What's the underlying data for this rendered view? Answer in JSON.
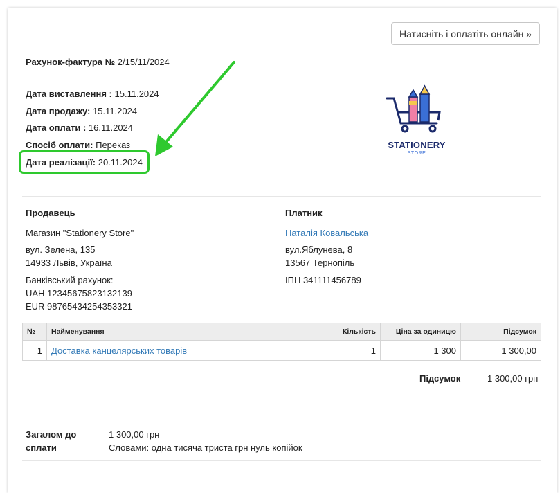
{
  "pay_button": {
    "label": "Натисніть і оплатіть онлайн »"
  },
  "invoice": {
    "title_label": "Рахунок-фактура №",
    "number": "2/15/11/2024"
  },
  "dates": [
    {
      "label": "Дата виставлення :",
      "value": "15.11.2024"
    },
    {
      "label": "Дата продажу:",
      "value": "15.11.2024"
    },
    {
      "label": "Дата оплати :",
      "value": "16.11.2024"
    },
    {
      "label": "Спосіб оплати:",
      "value": "Переказ"
    },
    {
      "label": "Дата реалізації:",
      "value": "20.11.2024"
    }
  ],
  "logo": {
    "name": "STATIONERY",
    "sub": "STORE"
  },
  "seller": {
    "heading": "Продавець",
    "name": "Магазин \"Stationery Store\"",
    "address1": "вул. Зелена, 135",
    "address2": "14933 Львів, Україна",
    "bank_label": "Банківський рахунок:",
    "bank_uah": "UAH 12345675823132139",
    "bank_eur": "EUR 98765434254353321"
  },
  "payer": {
    "heading": "Платник",
    "name": "Наталія Ковальська",
    "address1": "вул.Яблунева, 8",
    "address2": "13567 Тернопіль",
    "tax_id": "ІПН 341111456789"
  },
  "table": {
    "headers": {
      "no": "№",
      "name": "Найменування",
      "qty": "Кількість",
      "price": "Ціна за одиницю",
      "subtotal": "Підсумок"
    },
    "rows": [
      {
        "no": "1",
        "name": "Доставка канцелярських товарів",
        "qty": "1",
        "price": "1 300",
        "subtotal": "1 300,00"
      }
    ]
  },
  "subtotal": {
    "label": "Підсумок",
    "value": "1 300,00 грн"
  },
  "total": {
    "label": "Загалом до сплати",
    "amount": "1 300,00 грн",
    "words": "Словами: одна тисяча триста грн нуль копійок"
  },
  "colors": {
    "highlight": "#2ec92e",
    "link": "#337ab7",
    "logo_dark": "#1b2a6b"
  }
}
